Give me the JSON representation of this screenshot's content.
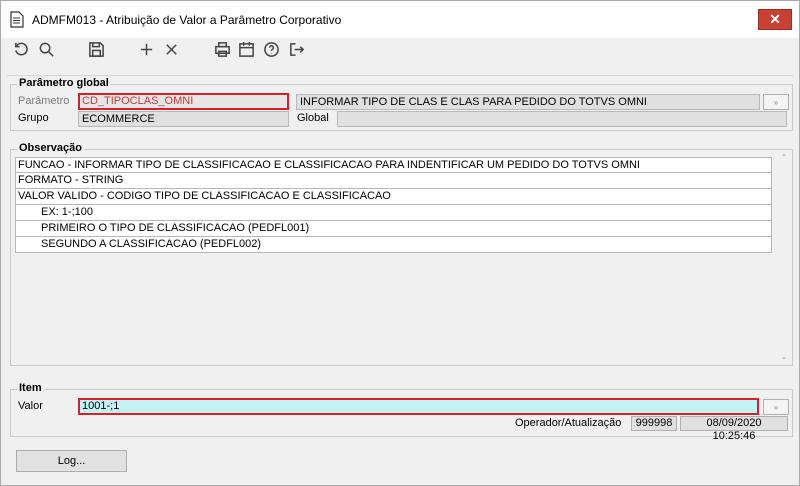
{
  "window": {
    "title": "ADMFM013 - Atribuição de Valor a Parâmetro Corporativo",
    "close_label": "✕"
  },
  "toolbar": {
    "icons": [
      "undo-icon",
      "search-icon",
      "save-icon",
      "add-icon",
      "delete-icon",
      "print-icon",
      "calendar-icon",
      "help-icon",
      "exit-icon"
    ]
  },
  "parametro_global": {
    "legend": "Parâmetro global",
    "parametro_label": "Parâmetro",
    "parametro_value": "CD_TIPOCLAS_OMNI",
    "parametro_desc": "INFORMAR TIPO DE CLAS E CLAS PARA PEDIDO DO TOTVS OMNI",
    "grupo_label": "Grupo",
    "grupo_value": "ECOMMERCE",
    "global_label": "Global",
    "global_value": ""
  },
  "observacao": {
    "legend": "Observação",
    "lines": [
      "FUNCAO - INFORMAR TIPO DE CLASSIFICACAO E CLASSIFICACAO PARA INDENTIFICAR UM PEDIDO DO TOTVS OMNI",
      "FORMATO - STRING",
      "VALOR VALIDO - CODIGO TIPO DE CLASSIFICACAO E CLASSIFICACAO",
      "EX: 1-;100",
      "PRIMEIRO O TIPO DE CLASSIFICACAO (PEDFL001)",
      "SEGUNDO A CLASSIFICACAO (PEDFL002)"
    ]
  },
  "item": {
    "legend": "Item",
    "valor_label": "Valor",
    "valor_value": "1001-;1",
    "operador_label": "Operador/Atualização",
    "operador_value": "999998",
    "atualizacao_value": "08/09/2020 10:25:46"
  },
  "footer": {
    "log_label": "Log..."
  },
  "colors": {
    "accent_border": "#d8202a",
    "active_field": "#c3f3f5",
    "close": "#c84031"
  }
}
